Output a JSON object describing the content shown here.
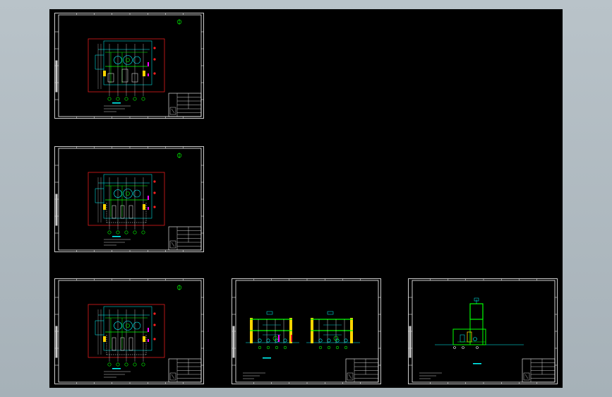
{
  "app": {
    "canvas_background": "#000000",
    "workspace_background": "#aab4bb"
  },
  "colors": {
    "frame": "#ffffff",
    "cyan": "#00ffff",
    "red": "#ff2020",
    "green": "#00ff00",
    "yellow": "#ffd400",
    "magenta": "#ff00ff",
    "blue": "#4a6bff"
  },
  "sheets": [
    {
      "name": "sheet-plan-1",
      "view": "plan",
      "variant": 1
    },
    {
      "name": "sheet-plan-2",
      "view": "plan",
      "variant": 2
    },
    {
      "name": "sheet-plan-3",
      "view": "plan",
      "variant": 3
    },
    {
      "name": "sheet-section",
      "view": "section"
    },
    {
      "name": "sheet-elevation",
      "view": "elevation"
    }
  ]
}
